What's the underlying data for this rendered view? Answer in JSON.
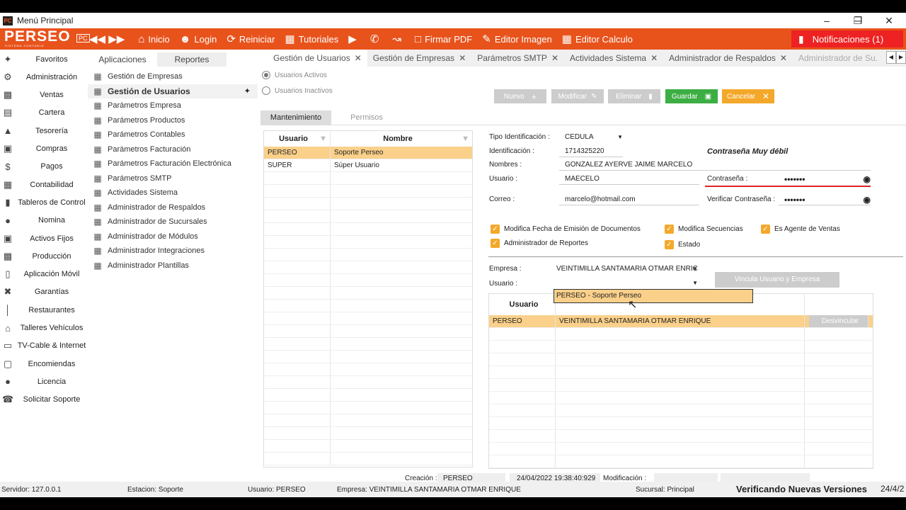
{
  "window": {
    "title": "Menú Principal"
  },
  "toolbar": {
    "logo": "PERSEO",
    "logo_badge": "PC",
    "logo_sub": "SISTEMA CONTABLE",
    "inicio": "Inicio",
    "login": "Login",
    "reiniciar": "Reiniciar",
    "tutoriales": "Tutoriales",
    "firmar": "Firmar PDF",
    "editor_imagen": "Editor Imagen",
    "editor_calculo": "Editor Calculo",
    "notificaciones": "Notificaciones (1)"
  },
  "nav": [
    {
      "label": "Favoritos",
      "icon": "pin-icon"
    },
    {
      "label": "Administración",
      "icon": "admin-icon"
    },
    {
      "label": "Ventas",
      "icon": "sales-icon"
    },
    {
      "label": "Cartera",
      "icon": "wallet-icon"
    },
    {
      "label": "Tesorería",
      "icon": "treasury-icon"
    },
    {
      "label": "Compras",
      "icon": "truck-icon"
    },
    {
      "label": "Pagos",
      "icon": "cash-icon"
    },
    {
      "label": "Contabilidad",
      "icon": "calculator-icon"
    },
    {
      "label": "Tableros de Control",
      "icon": "chart-icon"
    },
    {
      "label": "Nomina",
      "icon": "person-icon"
    },
    {
      "label": "Activos Fijos",
      "icon": "assets-icon"
    },
    {
      "label": "Producción",
      "icon": "factory-icon"
    },
    {
      "label": "Aplicación Móvil",
      "icon": "mobile-icon"
    },
    {
      "label": "Garantías",
      "icon": "tools-icon"
    },
    {
      "label": "Restaurantes",
      "icon": "fork-knife-icon"
    },
    {
      "label": "Talleres Vehículos",
      "icon": "garage-icon"
    },
    {
      "label": "TV-Cable & Internet",
      "icon": "tv-icon"
    },
    {
      "label": "Encomiendas",
      "icon": "package-icon"
    },
    {
      "label": "Licencia",
      "icon": "license-icon"
    },
    {
      "label": "Solicitar Soporte",
      "icon": "support-icon"
    }
  ],
  "subtabs": [
    "Aplicaciones",
    "Reportes"
  ],
  "subitems": [
    "Gestión de Empresas",
    "Gestión de Usuarios",
    "Parámetros Empresa",
    "Parámetros Productos",
    "Parámetros Contables",
    "Parámetros Facturación",
    "Parámetros Facturación Electrónica",
    "Parámetros SMTP",
    "Actividades Sistema",
    "Administrador de Respaldos",
    "Administrador de Sucursales",
    "Administrador de Módulos",
    "Administrador Integraciones",
    "Administrador Plantillas"
  ],
  "tabs": [
    "Gestión de Usuarios",
    "Gestión de Empresas",
    "Parámetros SMTP",
    "Actividades Sistema",
    "Administrador de Respaldos",
    "Administrador de Su..."
  ],
  "filter": {
    "activos": "Usuarios Activos",
    "inactivos": "Usuarios Inactivos"
  },
  "buttons": {
    "nuevo": "Nuevo",
    "modificar": "Modificar",
    "eliminar": "Eliminar",
    "guardar": "Guardar",
    "cancelar": "Cancelar"
  },
  "form_tabs": [
    "Mantenimiento",
    "Permisos"
  ],
  "users_grid": {
    "headers": [
      "Usuario",
      "Nombre"
    ],
    "rows": [
      [
        "PERSEO",
        "Soporte Perseo"
      ],
      [
        "SUPER",
        "Súper Usuario"
      ]
    ]
  },
  "form": {
    "tipo_label": "Tipo Identificación :",
    "tipo": "CEDULA",
    "id_label": "Identificación :",
    "id": "1714325220",
    "pw_strength": "Contraseña Muy débil",
    "nombres_label": "Nombres :",
    "nombres": "GONZALEZ AYERVE JAIME MARCELO",
    "usuario_label": "Usuario :",
    "usuario": "MAECELO",
    "pw_label": "Contraseña :",
    "pw": "•••••••",
    "correo_label": "Correo :",
    "correo": "marcelo@hotmail.com",
    "vpw_label": "Verificar Contraseña :",
    "vpw": "•••••••"
  },
  "checks": [
    "Modifica Fecha de Emisión de Documentos",
    "Administrador de Reportes",
    "Modifica Secuencias",
    "Estado",
    "Es Agente de Ventas"
  ],
  "empresa": {
    "empresa_label": "Empresa :",
    "empresa": "VEINTIMILLA SANTAMARIA OTMAR ENRIC",
    "usuario_label": "Usuario :",
    "vincular": "Vincula Usuario y Empresa",
    "dropdown": "PERSEO - Soporte Perseo"
  },
  "link_grid": {
    "header": "Usuario",
    "row": [
      "PERSEO",
      "VEINTIMILLA SANTAMARIA OTMAR ENRIQUE",
      "Desvincular"
    ]
  },
  "footer": {
    "creacion_label": "Creación :",
    "creacion": "PERSEO",
    "fecha": "24/04/2022 19:38:40:929",
    "mod_label": "Modificación :"
  },
  "status": {
    "servidor": "Servidor: 127.0.0.1",
    "estacion": "Estacion: Soporte",
    "usuario": "Usuario: PERSEO",
    "empresa": "Empresa: VEINTIMILLA SANTAMARIA OTMAR ENRIQUE",
    "sucursal": "Sucursal: Principal",
    "msg": "Verificando Nuevas Versiones",
    "date": "24/4/2"
  },
  "colors": {
    "accent": "#e8531c",
    "selected": "#fad08a",
    "checkbox": "#f4a82a",
    "guardar": "#3cae43",
    "cancelar": "#f4a82a"
  }
}
